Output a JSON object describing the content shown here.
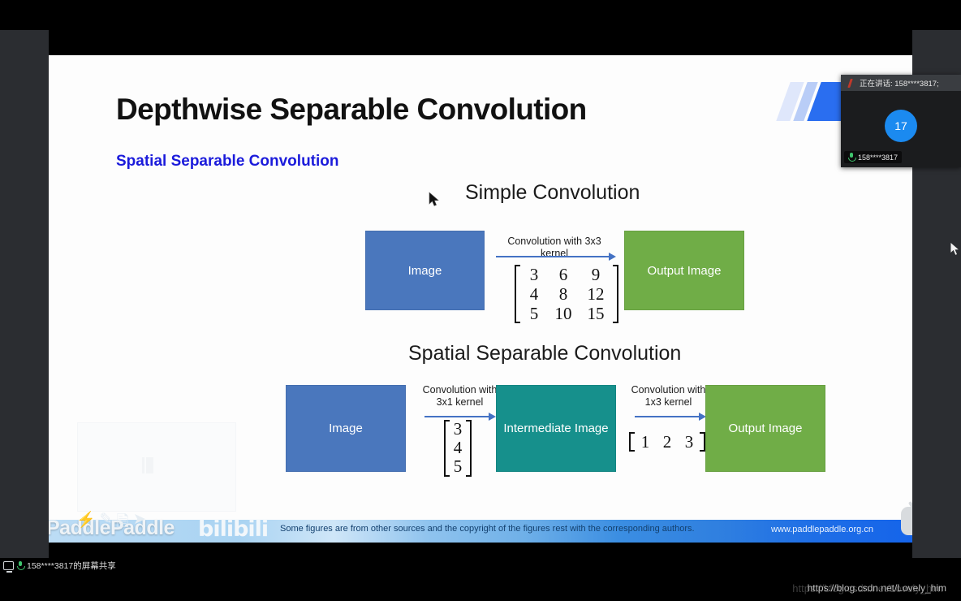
{
  "window": {
    "share_band_label": ""
  },
  "slide": {
    "title": "Depthwise Separable Convolution",
    "subtitle": "Spatial Separable Convolution",
    "logo_glyph": "飞桨",
    "sections": [
      {
        "heading": "Simple Convolution",
        "input_box": "Image",
        "output_box": "Output Image",
        "arrow_label": "Convolution with 3x3 kernel",
        "kernel": [
          [
            "3",
            "6",
            "9"
          ],
          [
            "4",
            "8",
            "12"
          ],
          [
            "5",
            "10",
            "15"
          ]
        ]
      },
      {
        "heading": "Spatial Separable Convolution",
        "input_box": "Image",
        "middle_box": "Intermediate Image",
        "output_box": "Output Image",
        "arrow_label_1": "Convolution with\n3x1 kernel",
        "arrow_label_1_line1": "Convolution with",
        "arrow_label_1_line2": "3x1 kernel",
        "arrow_label_2_line1": "Convolution with",
        "arrow_label_2_line2": "1x3 kernel",
        "kernel_col": [
          [
            "3"
          ],
          [
            "4"
          ],
          [
            "5"
          ]
        ],
        "kernel_row": [
          [
            "1",
            "2",
            "3"
          ]
        ]
      }
    ],
    "footer": {
      "note": "Some figures are from other sources and the copyright of the figures rest with the corresponding authors.",
      "url": "www.paddlepaddle.org.cn"
    },
    "watermark": {
      "brand": "飞桨PaddlePaddle",
      "bilibili": "bilibili"
    }
  },
  "video_panel": {
    "header_text": "正在讲话: 158****3817;",
    "avatar_initials": "17",
    "participant_name": "158****3817"
  },
  "taskbar": {
    "share_status": "158****3817的屏幕共享"
  },
  "overlay": {
    "csdn_url": "https://blog.csdn.net/Lovely_him"
  },
  "colors": {
    "image_box": "#4a77bd",
    "output_box": "#70ad47",
    "intermediate_box": "#16908c",
    "arrow": "#4472c4",
    "subtitle": "#1b1bdb",
    "avatar": "#1b8af0",
    "mic_active": "#3ec46d"
  }
}
